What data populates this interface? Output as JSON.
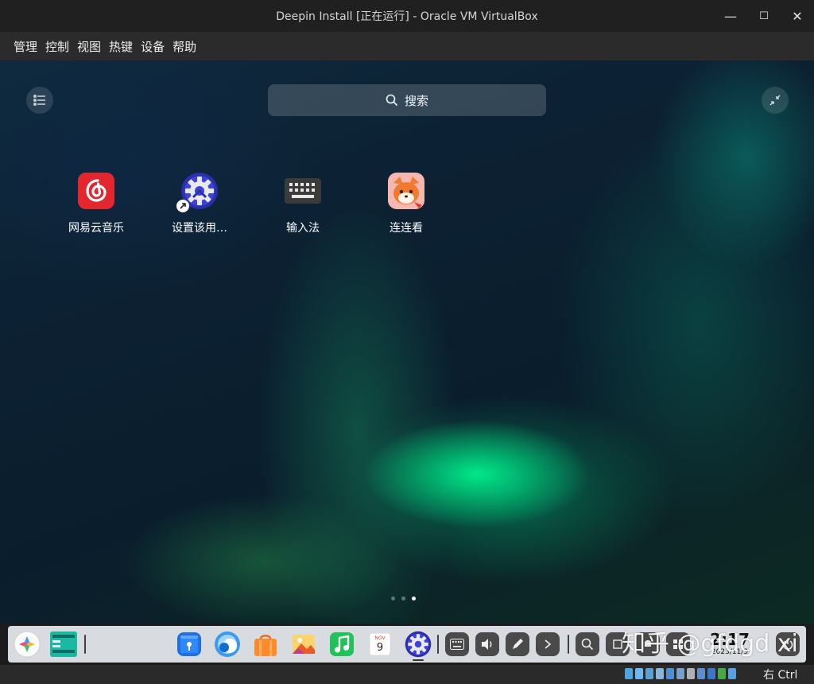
{
  "window": {
    "title": "Deepin Install [正在运行] - Oracle VM VirtualBox",
    "controls": {
      "minimize": "—",
      "maximize": "☐",
      "close": "✕"
    }
  },
  "menubar": {
    "items": [
      "管理",
      "控制",
      "视图",
      "热键",
      "设备",
      "帮助"
    ]
  },
  "launcher": {
    "search_label": "搜索",
    "apps": [
      {
        "label": "网易云音乐",
        "icon": "netease-music-icon"
      },
      {
        "label": "设置该用…",
        "icon": "settings-gear-icon"
      },
      {
        "label": "输入法",
        "icon": "keyboard-icon"
      },
      {
        "label": "连连看",
        "icon": "fox-game-icon"
      }
    ],
    "pages": {
      "count": 3,
      "current": 3
    }
  },
  "dock": {
    "apps": [
      "launcher-icon",
      "multitask-view-icon",
      "app-store-icon",
      "browser-icon",
      "store-bag-icon",
      "photos-icon",
      "music-icon",
      "calendar-icon",
      "settings-gear-icon"
    ],
    "calendar": {
      "month": "NOV",
      "day": "9"
    },
    "tray": [
      "keyboard-icon",
      "volume-icon",
      "pen-icon",
      "chevron-right-icon",
      "search-icon"
    ],
    "clock": {
      "time": "2:17",
      "date": "2023/11/9"
    }
  },
  "watermark": "知乎 @gfdgd xi",
  "statusbar": {
    "host_key": "右 Ctrl",
    "icon_colors": [
      "#4fa3e0",
      "#6fb8ef",
      "#5ba0d0",
      "#8ab4d8",
      "#4f8fd0",
      "#78a0c8",
      "#b0b0b0",
      "#5d8fd0",
      "#3c76c4",
      "#48a848",
      "#5aa0e0"
    ]
  },
  "colors": {
    "titlebar_bg": "#202020",
    "menubar_bg": "#2b2b2b",
    "accent_green": "#00f08c",
    "netease_red": "#e4262f"
  }
}
